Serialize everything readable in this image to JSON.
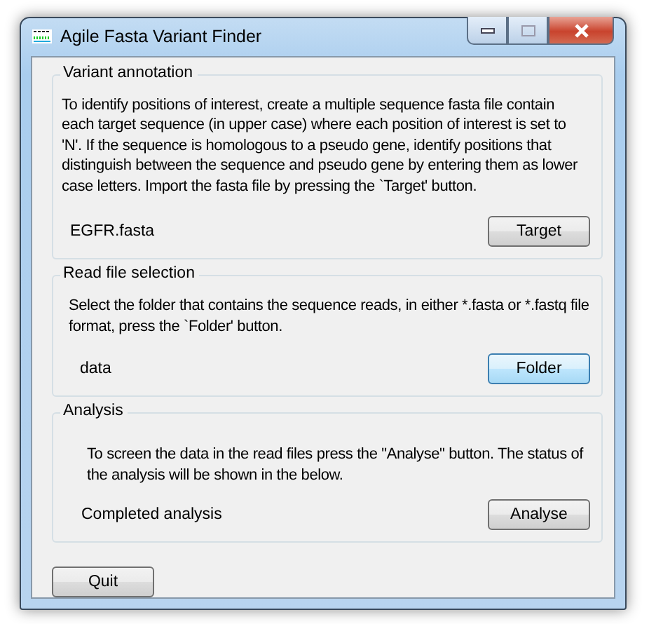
{
  "window": {
    "title": "Agile Fasta Variant Finder"
  },
  "groups": [
    {
      "title": "Variant annotation",
      "description": "To identify positions of interest, create a multiple sequence fasta file contain each target sequence (in upper case) where each position of interest is set to 'N'.  If the sequence is homologous to a pseudo gene, identify positions that distinguish between the sequence and pseudo gene by entering them as lower case letters. Import the fasta file by pressing the `Target' button.",
      "status": "EGFR.fasta",
      "button": {
        "label": "Target",
        "focused": false
      }
    },
    {
      "title": "Read file selection",
      "description": "Select the folder that contains the sequence reads, in either *.fasta or *.fastq file format, press the `Folder' button.",
      "status": "data",
      "button": {
        "label": "Folder",
        "focused": true
      }
    },
    {
      "title": "Analysis",
      "description": "To screen the data in the read files press the \"Analyse\" button. The status of the analysis will be shown in the below.",
      "status": "Completed analysis",
      "button": {
        "label": "Analyse",
        "focused": false
      }
    }
  ],
  "quit_button": {
    "label": "Quit",
    "focused": false
  }
}
